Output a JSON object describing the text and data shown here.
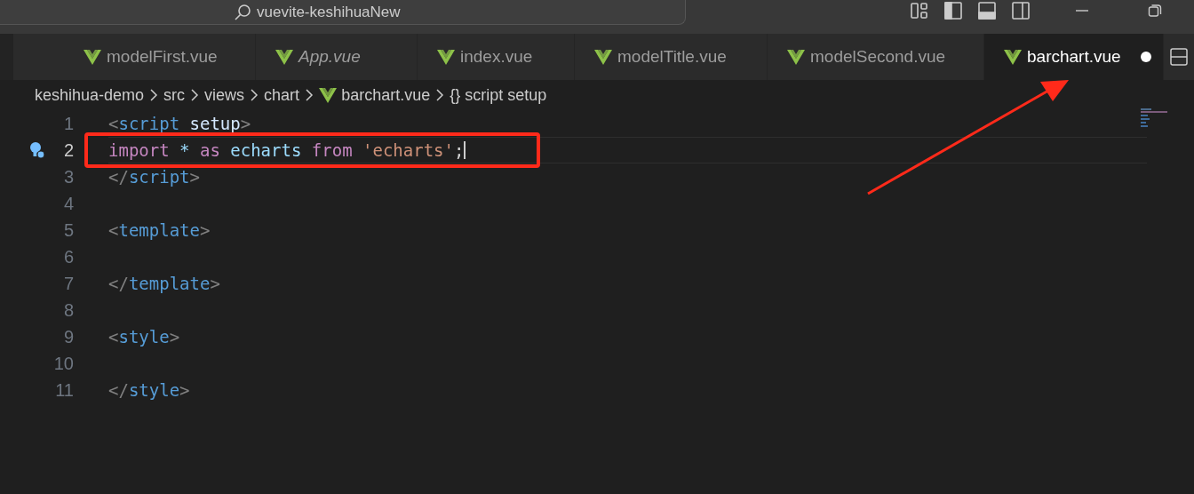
{
  "title_bar": {
    "search_text": "vuevite-keshihuaNew"
  },
  "tabs": [
    {
      "label": "modelFirst.vue",
      "selected": false,
      "preview": false,
      "modified": false
    },
    {
      "label": "App.vue",
      "selected": false,
      "preview": true,
      "modified": false
    },
    {
      "label": "index.vue",
      "selected": false,
      "preview": false,
      "modified": false
    },
    {
      "label": "modelTitle.vue",
      "selected": false,
      "preview": false,
      "modified": false
    },
    {
      "label": "modelSecond.vue",
      "selected": false,
      "preview": false,
      "modified": false
    },
    {
      "label": "barchart.vue",
      "selected": true,
      "preview": false,
      "modified": true
    }
  ],
  "breadcrumb": [
    {
      "kind": "folder",
      "text": "keshihua-demo"
    },
    {
      "kind": "folder",
      "text": "src"
    },
    {
      "kind": "folder",
      "text": "views"
    },
    {
      "kind": "folder",
      "text": "chart"
    },
    {
      "kind": "file",
      "text": "barchart.vue"
    },
    {
      "kind": "symbol",
      "text": "script setup",
      "icon": "{}"
    }
  ],
  "editor": {
    "lines": [
      {
        "number": "1",
        "current": false,
        "tokens": [
          {
            "kind": "punct",
            "text": "<"
          },
          {
            "kind": "tag",
            "text": "script"
          },
          {
            "kind": "attr",
            "text": " setup"
          },
          {
            "kind": "punct",
            "text": ">"
          }
        ]
      },
      {
        "number": "2",
        "current": true,
        "tokens": [
          {
            "kind": "keyword",
            "text": "import"
          },
          {
            "kind": "var",
            "text": " * "
          },
          {
            "kind": "keyword",
            "text": "as"
          },
          {
            "kind": "var",
            "text": " echarts "
          },
          {
            "kind": "keyword",
            "text": "from"
          },
          {
            "kind": "string",
            "text": " 'echarts'"
          },
          {
            "kind": "plain",
            "text": ";"
          }
        ]
      },
      {
        "number": "3",
        "current": false,
        "tokens": [
          {
            "kind": "punct",
            "text": "</"
          },
          {
            "kind": "tag",
            "text": "script"
          },
          {
            "kind": "punct",
            "text": ">"
          }
        ]
      },
      {
        "number": "4",
        "current": false
      },
      {
        "number": "5",
        "current": false,
        "tokens": [
          {
            "kind": "punct",
            "text": "<"
          },
          {
            "kind": "tag",
            "text": "template"
          },
          {
            "kind": "punct",
            "text": ">"
          }
        ]
      },
      {
        "number": "6",
        "current": false
      },
      {
        "number": "7",
        "current": false,
        "tokens": [
          {
            "kind": "punct",
            "text": "</"
          },
          {
            "kind": "tag",
            "text": "template"
          },
          {
            "kind": "punct",
            "text": ">"
          }
        ]
      },
      {
        "number": "8",
        "current": false
      },
      {
        "number": "9",
        "current": false,
        "tokens": [
          {
            "kind": "punct",
            "text": "<"
          },
          {
            "kind": "tag",
            "text": "style"
          },
          {
            "kind": "punct",
            "text": ">"
          }
        ]
      },
      {
        "number": "10",
        "current": false
      },
      {
        "number": "11",
        "current": false,
        "tokens": [
          {
            "kind": "punct",
            "text": "</"
          },
          {
            "kind": "tag",
            "text": "style"
          },
          {
            "kind": "punct",
            "text": ">"
          }
        ]
      }
    ]
  }
}
